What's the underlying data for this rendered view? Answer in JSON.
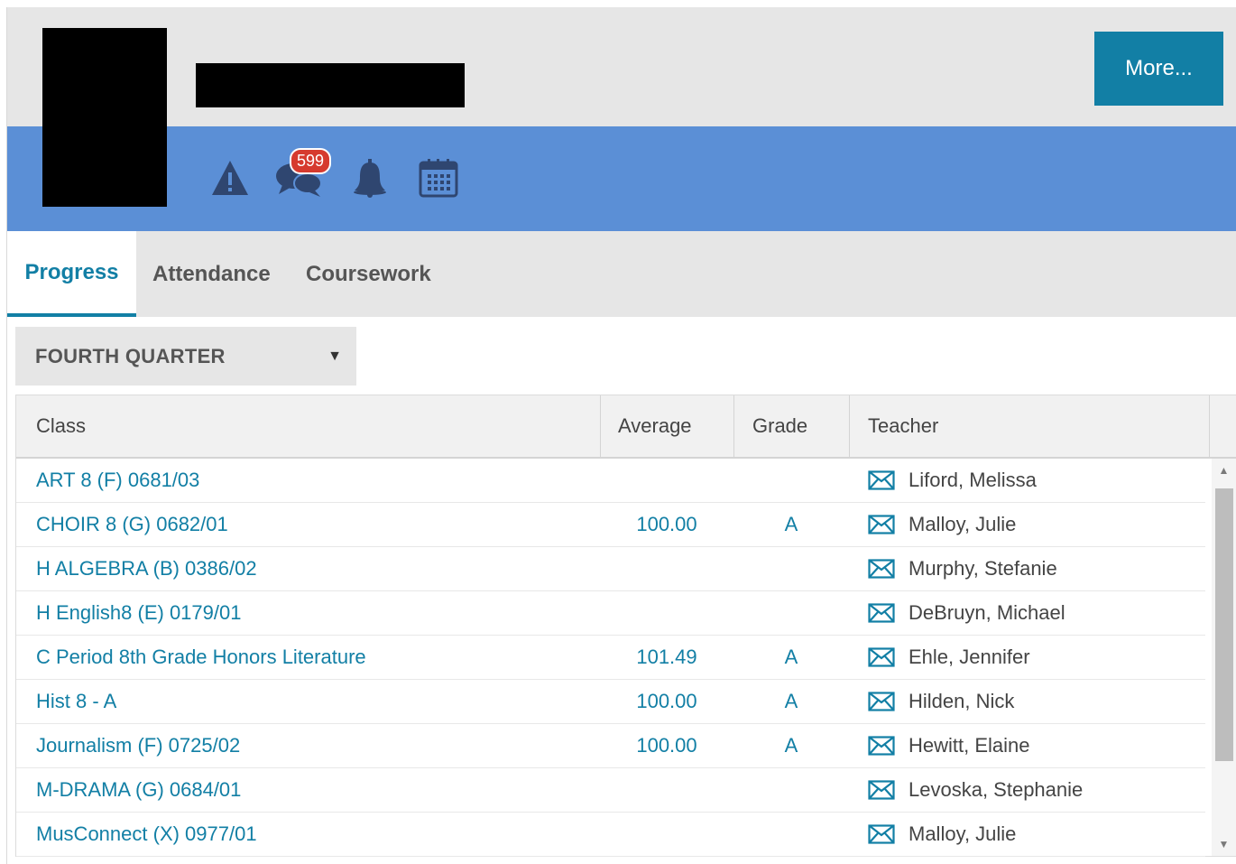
{
  "header": {
    "more_label": "More...",
    "notification_badge": "599",
    "icons": [
      "warning-icon",
      "messages-icon",
      "bell-icon",
      "calendar-icon"
    ]
  },
  "tabs": [
    {
      "label": "Progress",
      "active": true
    },
    {
      "label": "Attendance",
      "active": false
    },
    {
      "label": "Coursework",
      "active": false
    }
  ],
  "term_select": {
    "selected": "FOURTH QUARTER"
  },
  "table": {
    "columns": [
      "Class",
      "Average",
      "Grade",
      "Teacher"
    ],
    "rows": [
      {
        "class": "ART 8 (F) 0681/03",
        "average": "",
        "grade": "",
        "teacher": "Liford, Melissa"
      },
      {
        "class": "CHOIR 8 (G) 0682/01",
        "average": "100.00",
        "grade": "A",
        "teacher": "Malloy, Julie"
      },
      {
        "class": "H ALGEBRA (B) 0386/02",
        "average": "",
        "grade": "",
        "teacher": "Murphy, Stefanie"
      },
      {
        "class": "H English8 (E) 0179/01",
        "average": "",
        "grade": "",
        "teacher": "DeBruyn, Michael"
      },
      {
        "class": "C Period 8th Grade Honors Literature",
        "average": "101.49",
        "grade": "A",
        "teacher": "Ehle, Jennifer"
      },
      {
        "class": "Hist 8 - A",
        "average": "100.00",
        "grade": "A",
        "teacher": "Hilden, Nick"
      },
      {
        "class": "Journalism (F) 0725/02",
        "average": "100.00",
        "grade": "A",
        "teacher": "Hewitt, Elaine"
      },
      {
        "class": "M-DRAMA (G) 0684/01",
        "average": "",
        "grade": "",
        "teacher": "Levoska, Stephanie"
      },
      {
        "class": "MusConnect (X) 0977/01",
        "average": "",
        "grade": "",
        "teacher": "Malloy, Julie"
      }
    ]
  },
  "colors": {
    "accent": "#127fa5",
    "header_bar": "#5b8fd6",
    "badge": "#d63a2e",
    "icon": "#2f4670"
  }
}
